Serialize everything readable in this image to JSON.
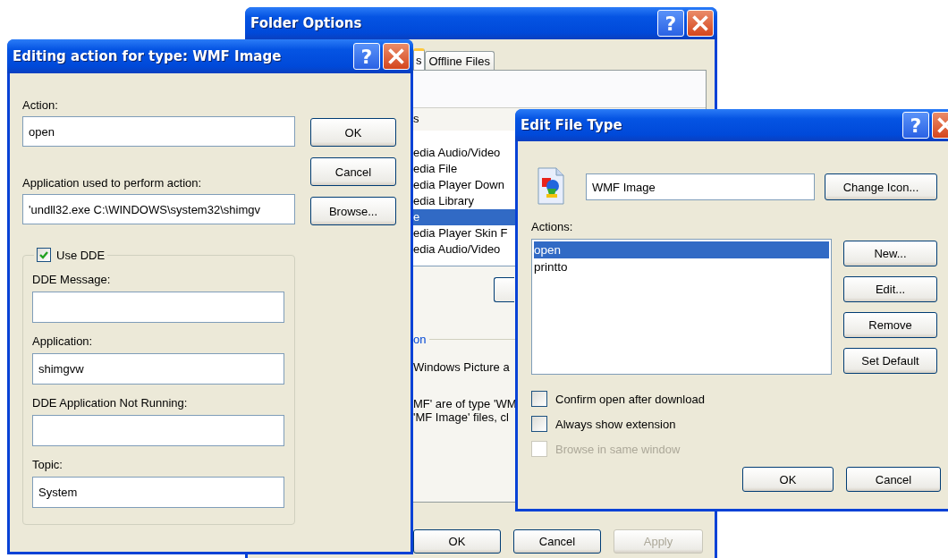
{
  "folder_options": {
    "title": "Folder Options",
    "help": "?",
    "tabs": [
      {
        "label": "s",
        "selected": true
      },
      {
        "label": "Offline Files",
        "selected": false
      }
    ],
    "list_label": "s",
    "file_types": [
      {
        "label": "edia Audio/Video",
        "selected": false
      },
      {
        "label": "edia File",
        "selected": false
      },
      {
        "label": "edia Player Down",
        "selected": false
      },
      {
        "label": "edia Library",
        "selected": false
      },
      {
        "label": "e",
        "selected": true
      },
      {
        "label": "edia Player Skin F",
        "selected": false
      },
      {
        "label": "edia Audio/Video",
        "selected": false
      }
    ],
    "group_label": "on",
    "details": [
      "Windows Picture a",
      "MF' are of type 'WM",
      "'MF Image' files, cl"
    ],
    "buttons": [
      {
        "label": "OK",
        "disabled": false
      },
      {
        "label": "Cancel",
        "disabled": false
      },
      {
        "label": "Apply",
        "disabled": true
      }
    ]
  },
  "editing_action": {
    "title": "Editing action for type: WMF Image",
    "help": "?",
    "action": {
      "label": "Action:",
      "value": "open"
    },
    "application": {
      "label": "Application used to perform action:",
      "value": "'undll32.exe C:\\WINDOWS\\system32\\shimgv"
    },
    "buttons": [
      "OK",
      "Cancel",
      "Browse..."
    ],
    "use_dde": {
      "label": "Use DDE",
      "checked": true
    },
    "dde_fields": [
      {
        "label": "DDE Message:"
      },
      {
        "label": "Application:",
        "value": "shimgvw"
      },
      {
        "label": "DDE Application Not Running:"
      },
      {
        "label": "Topic:",
        "value": "System"
      }
    ]
  },
  "edit_file_type": {
    "title": "Edit File Type",
    "help": "?",
    "type_name": "WMF Image",
    "change_icon": "Change Icon...",
    "actions_label": "Actions:",
    "actions": [
      {
        "label": "open",
        "selected": true
      },
      {
        "label": "printto",
        "selected": false
      }
    ],
    "action_buttons": [
      "New...",
      "Edit...",
      "Remove",
      "Set Default"
    ],
    "options": [
      {
        "label": "Confirm open after download",
        "checked": false,
        "disabled": false
      },
      {
        "label": "Always show extension",
        "checked": false,
        "disabled": false
      },
      {
        "label": "Browse in same window",
        "checked": false,
        "disabled": true
      }
    ],
    "buttons": [
      "OK",
      "Cancel"
    ]
  }
}
